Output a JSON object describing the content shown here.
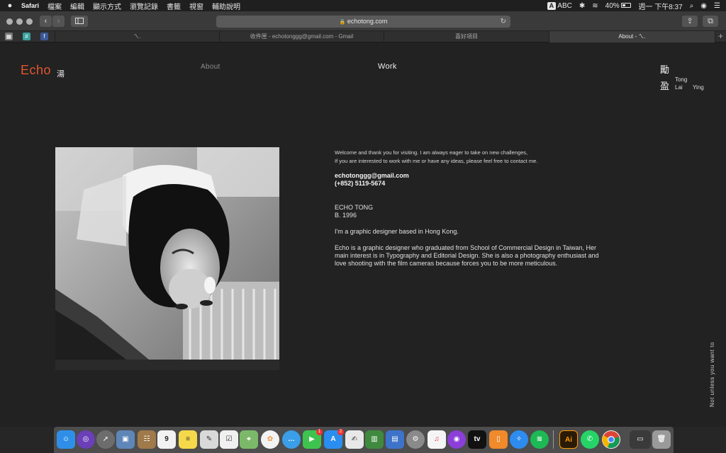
{
  "menubar": {
    "app": "Safari",
    "items": [
      "檔案",
      "編輯",
      "顯示方式",
      "瀏覽記錄",
      "書籤",
      "視窗",
      "輔助說明"
    ],
    "input_source_badge": "A",
    "input_source": "ABC",
    "battery": "40%",
    "clock": "週一 下午8:37"
  },
  "toolbar": {
    "url": "echotong.com",
    "back": "‹",
    "forward": "›"
  },
  "tabs": [
    {
      "label": "ㄟ."
    },
    {
      "label": "收件匣 - echotonggg@gmail.com - Gmail"
    },
    {
      "label": "喜好項目"
    },
    {
      "label": "About - ㄟ."
    }
  ],
  "tab_add": "+",
  "site": {
    "logo": "Echo",
    "logo_cjk": "湯",
    "nav_about": "About",
    "nav_work": "Work",
    "side_cjk_1": "勵",
    "side_cjk_2": "盈",
    "side_latin_1": "Tong",
    "side_latin_2": "Lai",
    "side_latin_3": "Ying",
    "welcome_line_1": "Welcome and thank you for visiting. I am always eager to take on new challenges,",
    "welcome_line_2": "If you are interested to work with me or have any ideas, please feel free to contact me.",
    "email": "echotonggg@gmail.com",
    "phone": "(+852) 5119-5674",
    "name": "ECHO TONG",
    "born": "B. 1996",
    "intro": "I'm a  graphic designer based in Hong Kong.",
    "bio_line_1": "Echo is a graphic designer who graduated from School of Commercial Design in Taiwan, Her",
    "bio_line_2": "main interest is in Typography and Editorial Design. She is also a photography enthusiast and",
    "bio_line_3": "love shooting with the film cameras because forces you to be more meticulous.",
    "vertical_text": "Not unless you want to"
  },
  "dock": {
    "calendar_day": "9",
    "mail_badge": "1",
    "appstore_badge": "2",
    "illustrator_label": "Ai",
    "tv_label": "tv"
  }
}
